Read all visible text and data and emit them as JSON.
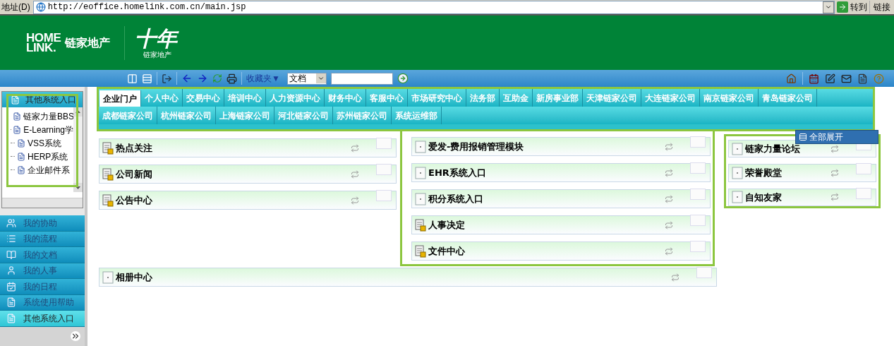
{
  "address_bar": {
    "label": "地址(D)",
    "url": "http://eoffice.homelink.com.cn/main.jsp",
    "go_button": "转到",
    "links": "链接"
  },
  "header": {
    "logo_en_top": "HOME",
    "logo_en_bottom": "LINK.",
    "logo_cn": "链家地产",
    "anniversary": "十年",
    "anniversary_sub": "链家地产"
  },
  "toolbar": {
    "favorites": "收藏夹▼",
    "search_scope": "文档"
  },
  "sidebar": {
    "tree": {
      "title": "其他系统入口",
      "items": [
        "链家力量BBS",
        "E-Learning学",
        "VSS系统",
        "HERP系统",
        "企业邮件系"
      ]
    },
    "menu": [
      {
        "label": "我的协助",
        "selected": false
      },
      {
        "label": "我的流程",
        "selected": false
      },
      {
        "label": "我的文档",
        "selected": false
      },
      {
        "label": "我的人事",
        "selected": false
      },
      {
        "label": "我的日程",
        "selected": false
      },
      {
        "label": "系统使用帮助",
        "selected": false
      },
      {
        "label": "其他系统入口",
        "selected": true
      }
    ]
  },
  "tab_rows": [
    [
      {
        "label": "企业门户",
        "selected": true
      },
      {
        "label": "个人中心",
        "selected": false
      },
      {
        "label": "交易中心",
        "selected": false
      },
      {
        "label": "培训中心",
        "selected": false
      },
      {
        "label": "人力资源中心",
        "selected": false
      },
      {
        "label": "财务中心",
        "selected": false
      },
      {
        "label": "客服中心",
        "selected": false
      },
      {
        "label": "市场研究中心",
        "selected": false
      },
      {
        "label": "法务部",
        "selected": false
      },
      {
        "label": "互助金",
        "selected": false
      },
      {
        "label": "新房事业部",
        "selected": false
      },
      {
        "label": "天津链家公司",
        "selected": false
      },
      {
        "label": "大连链家公司",
        "selected": false
      },
      {
        "label": "南京链家公司",
        "selected": false
      },
      {
        "label": "青岛链家公司",
        "selected": false
      }
    ],
    [
      {
        "label": "成都链家公司",
        "selected": false
      },
      {
        "label": "杭州链家公司",
        "selected": false
      },
      {
        "label": "上海链家公司",
        "selected": false
      },
      {
        "label": "河北链家公司",
        "selected": false
      },
      {
        "label": "苏州链家公司",
        "selected": false
      },
      {
        "label": "系统运维部",
        "selected": false
      }
    ]
  ],
  "popup_menu": {
    "item": "全部展开"
  },
  "portlets": {
    "column_1": [
      {
        "title": "热点关注",
        "kind": "doc"
      },
      {
        "title": "公司新闻",
        "kind": "doc"
      },
      {
        "title": "公告中心",
        "kind": "doc"
      }
    ],
    "column_2": [
      {
        "title": "爱发-费用报销管理模块",
        "kind": "blank"
      },
      {
        "title": "EHR系统入口",
        "kind": "blank"
      },
      {
        "title": "积分系统入口",
        "kind": "blank"
      },
      {
        "title": "人事决定",
        "kind": "doc"
      },
      {
        "title": "文件中心",
        "kind": "doc"
      }
    ],
    "column_3": [
      {
        "title": "链家力量论坛",
        "kind": "blank"
      },
      {
        "title": "荣誉殿堂",
        "kind": "blank"
      },
      {
        "title": "自知友家",
        "kind": "blank"
      }
    ],
    "wide": [
      {
        "title": "相册中心",
        "kind": "blank"
      }
    ]
  }
}
